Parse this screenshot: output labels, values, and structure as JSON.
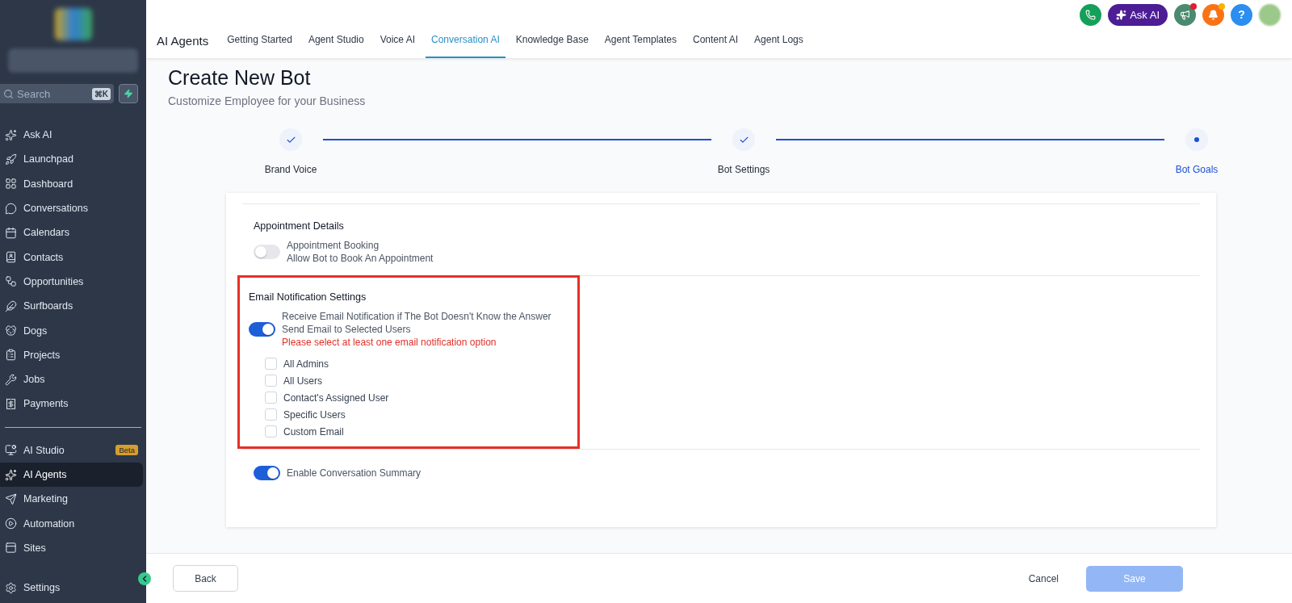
{
  "sidebar": {
    "search": {
      "placeholder": "Search",
      "shortcut": "⌘K"
    },
    "items": [
      {
        "label": "Ask AI",
        "selected": false
      },
      {
        "label": "Launchpad",
        "selected": false
      },
      {
        "label": "Dashboard",
        "selected": false
      },
      {
        "label": "Conversations",
        "selected": false
      },
      {
        "label": "Calendars",
        "selected": false
      },
      {
        "label": "Contacts",
        "selected": false
      },
      {
        "label": "Opportunities",
        "selected": false
      },
      {
        "label": "Surfboards",
        "selected": false
      },
      {
        "label": "Dogs",
        "selected": false
      },
      {
        "label": "Projects",
        "selected": false
      },
      {
        "label": "Jobs",
        "selected": false
      },
      {
        "label": "Payments",
        "selected": false
      }
    ],
    "secondary_items": [
      {
        "label": "AI Studio",
        "selected": false,
        "badge": "Beta"
      },
      {
        "label": "AI Agents",
        "selected": true
      },
      {
        "label": "Marketing",
        "selected": false
      },
      {
        "label": "Automation",
        "selected": false
      },
      {
        "label": "Sites",
        "selected": false
      }
    ],
    "settings": {
      "label": "Settings"
    }
  },
  "header": {
    "title": "AI Agents",
    "tabs": [
      {
        "label": "Getting Started",
        "selected": false
      },
      {
        "label": "Agent Studio",
        "selected": false
      },
      {
        "label": "Voice AI",
        "selected": false
      },
      {
        "label": "Conversation AI",
        "selected": true
      },
      {
        "label": "Knowledge Base",
        "selected": false
      },
      {
        "label": "Agent Templates",
        "selected": false
      },
      {
        "label": "Content AI",
        "selected": false
      },
      {
        "label": "Agent Logs",
        "selected": false
      }
    ],
    "ask_ai": "Ask AI",
    "help": "?"
  },
  "page": {
    "title": "Create New Bot",
    "subtitle": "Customize Employee for your Business",
    "steps": [
      {
        "label": "Brand Voice",
        "completed": true,
        "selected": false
      },
      {
        "label": "Bot Settings",
        "completed": true,
        "selected": false
      },
      {
        "label": "Bot Goals",
        "completed": false,
        "selected": true
      }
    ]
  },
  "appointment": {
    "heading": "Appointment Details",
    "toggle": {
      "title": "Appointment Booking",
      "subtitle": "Allow Bot to Book An Appointment",
      "on": false
    }
  },
  "email": {
    "heading": "Email Notification Settings",
    "highlighted": true,
    "toggle": {
      "title": "Receive Email Notification if The Bot Doesn't Know the Answer",
      "subtitle": "Send Email to Selected Users",
      "on": true
    },
    "error": "Please select at least one email notification option",
    "options": [
      {
        "label": "All Admins",
        "checked": false
      },
      {
        "label": "All Users",
        "checked": false
      },
      {
        "label": "Contact's Assigned User",
        "checked": false
      },
      {
        "label": "Specific Users",
        "checked": false
      },
      {
        "label": "Custom Email",
        "checked": false
      }
    ]
  },
  "summary": {
    "toggle": {
      "title": "Enable Conversation Summary",
      "on": true
    }
  },
  "footer": {
    "back": "Back",
    "cancel": "Cancel",
    "save": {
      "label": "Save",
      "disabled": true
    }
  }
}
